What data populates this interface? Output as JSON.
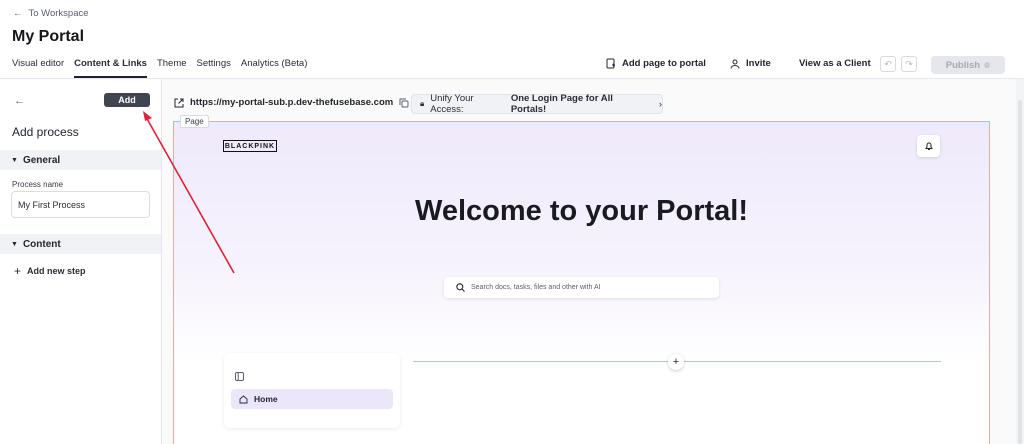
{
  "header": {
    "back_label": "To Workspace",
    "title": "My Portal",
    "tabs": [
      {
        "label": "Visual editor"
      },
      {
        "label": "Content & Links"
      },
      {
        "label": "Theme"
      },
      {
        "label": "Settings"
      },
      {
        "label": "Analytics (Beta)"
      }
    ],
    "add_page_label": "Add page to portal",
    "invite_label": "Invite",
    "view_client_label": "View as a Client",
    "publish_label": "Publish"
  },
  "left_panel": {
    "add_label": "Add",
    "title": "Add process",
    "general_label": "General",
    "process_name_label": "Process name",
    "process_name_value": "My First Process",
    "content_label": "Content",
    "add_step_label": "Add new step"
  },
  "canvas": {
    "url": "https://my-portal-sub.p.dev-thefusebase.com",
    "unify_prefix": "Unify Your Access:",
    "unify_bold": "One Login Page for All Portals!",
    "page_tag": "Page",
    "logo_text": "BLACKPINK",
    "welcome": "Welcome to your Portal!",
    "search_placeholder": "Search docs, tasks, files and other with AI",
    "home_label": "Home"
  },
  "colors": {
    "accent_dark": "#404552",
    "frame_border": "#9cc1ee",
    "annotation_arrow": "#d9253a",
    "selected_bg": "#ece6fa"
  }
}
